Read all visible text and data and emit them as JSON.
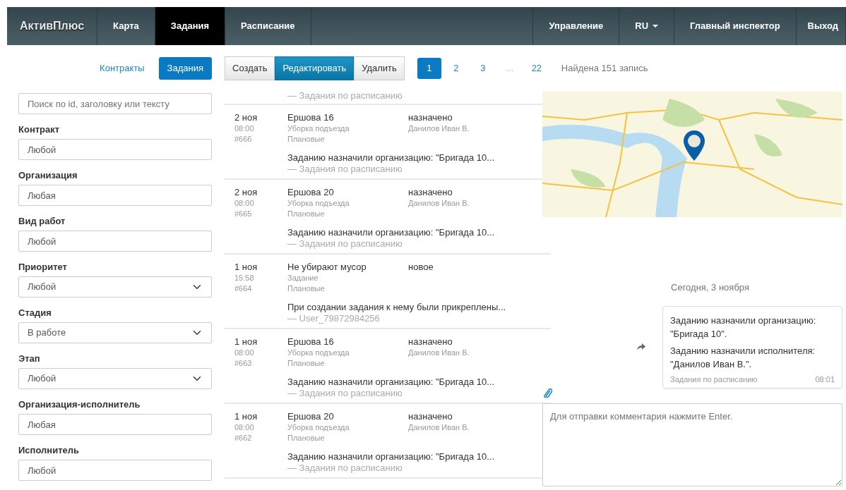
{
  "navbar": {
    "brand": "АктивПлюс",
    "items": [
      {
        "label": "Карта",
        "selected": false
      },
      {
        "label": "Задания",
        "selected": true
      },
      {
        "label": "Расписание",
        "selected": false
      }
    ],
    "right_items": [
      {
        "label": "Управление",
        "kind": "link"
      },
      {
        "label": "RU",
        "kind": "dropdown"
      },
      {
        "label": "Главный инспектор",
        "kind": "link"
      },
      {
        "label": "Выход",
        "kind": "link"
      }
    ]
  },
  "view_switch": [
    {
      "label": "Контракты",
      "selected": false
    },
    {
      "label": "Задания",
      "selected": true
    }
  ],
  "actions": [
    {
      "label": "Создать",
      "selected": false
    },
    {
      "label": "Редактировать",
      "selected": true
    },
    {
      "label": "Удалить",
      "selected": false
    }
  ],
  "pagination": [
    {
      "label": "1",
      "kind": "page",
      "selected": true
    },
    {
      "label": "2",
      "kind": "page",
      "selected": false
    },
    {
      "label": "3",
      "kind": "page",
      "selected": false
    },
    {
      "label": "...",
      "kind": "gap"
    },
    {
      "label": "22",
      "kind": "page",
      "selected": false
    }
  ],
  "found_text": "Найдена 151 запись",
  "search": {
    "placeholder": "Поиск по id, заголовку или тексту"
  },
  "filters": [
    {
      "label": "Контракт",
      "value": "Любой",
      "kind": "input"
    },
    {
      "label": "Организация",
      "value": "Любая",
      "kind": "input"
    },
    {
      "label": "Вид работ",
      "value": "Любой",
      "kind": "input"
    },
    {
      "label": "Приоритет",
      "value": "Любой",
      "kind": "select"
    },
    {
      "label": "Стадия",
      "value": "В работе",
      "kind": "select"
    },
    {
      "label": "Этап",
      "value": "Любой",
      "kind": "select"
    },
    {
      "label": "Организация-исполнитель",
      "value": "Любая",
      "kind": "input"
    },
    {
      "label": "Исполнитель",
      "value": "Любой",
      "kind": "input"
    }
  ],
  "tasks_top_author": "— Задания по расписанию",
  "tasks": [
    {
      "date": "2 ноя",
      "time": "08:00",
      "id": "#666",
      "title": "Ершова 16",
      "type": "Уборка подъезда",
      "category": "Плановые",
      "status": "назначено",
      "assignee": "Данилов Иван В.",
      "comment": "Заданию назначили организацию: \"Бригада 10...",
      "author": "— Задания по расписанию"
    },
    {
      "date": "2 ноя",
      "time": "08:00",
      "id": "#665",
      "title": "Ершова 20",
      "type": "Уборка подъезда",
      "category": "Плановые",
      "status": "назначено",
      "assignee": "Данилов Иван В.",
      "comment": "Заданию назначили организацию: \"Бригада 10...",
      "author": "— Задания по расписанию"
    },
    {
      "date": "1 ноя",
      "time": "15:58",
      "id": "#664",
      "title": "Не убирают мусор",
      "type": "Задание",
      "category": "Плановые",
      "status": "новое",
      "comment": "При создании задания к нему были прикреплены...",
      "author": "— User_79872984256"
    },
    {
      "date": "1 ноя",
      "time": "08:00",
      "id": "#663",
      "title": "Ершова 16",
      "type": "Уборка подъезда",
      "category": "Плановые",
      "status": "назначено",
      "assignee": "Данилов Иван В.",
      "comment": "Заданию назначили организацию: \"Бригада 10...",
      "author": "— Задания по расписанию"
    },
    {
      "date": "1 ноя",
      "time": "08:00",
      "id": "#662",
      "title": "Ершова 20",
      "type": "Уборка подъезда",
      "category": "Плановые",
      "status": "назначено",
      "assignee": "Данилов Иван В.",
      "comment": "Заданию назначили организацию: \"Бригада 10...",
      "author": "— Задания по расписанию"
    }
  ],
  "chat": {
    "day": "Сегодня, 3 ноября",
    "messages": [
      {
        "lines": [
          "Заданию назначили организацию: \"Бригада 10\".",
          "Заданию назначили исполнителя: \"Данилов Иван В.\"."
        ],
        "author": "Задания по расписанию",
        "time": "08:01"
      }
    ],
    "comment": {
      "placeholder": "Для отправки комментария нажмите Enter."
    }
  }
}
